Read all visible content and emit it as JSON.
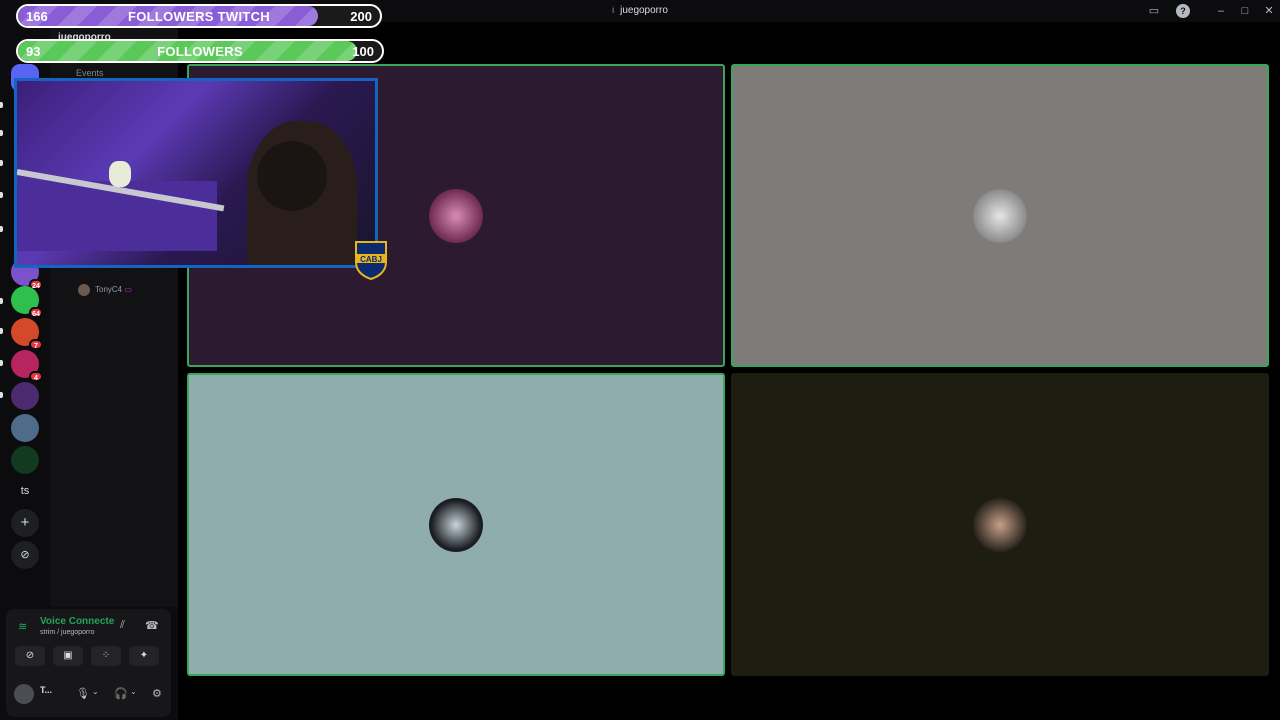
{
  "window": {
    "title": "juegoporro"
  },
  "overlay": {
    "twitch": {
      "current": "166",
      "label": "FOLLOWERS TWITCH",
      "goal": "200",
      "progress": 0.83,
      "color": "#8a5cd6"
    },
    "followers": {
      "current": "93",
      "label": "FOLLOWERS",
      "goal": "100",
      "progress": 0.93,
      "color": "#5ac95a"
    },
    "crest_label": "CABJ"
  },
  "server_header": {
    "name": "juegoporro"
  },
  "channels": {
    "events_label": "Events"
  },
  "members": [
    {
      "name": "TonyC4"
    }
  ],
  "rail": {
    "badges": [
      "24",
      "64",
      "7",
      "4"
    ],
    "text_server": "ts",
    "add_icon": "+",
    "discover_icon": "⊘"
  },
  "voice": {
    "status": "Voice Connecte",
    "channel": "strim / juegoporro"
  },
  "user": {
    "name": "T..."
  },
  "tiles": [
    {
      "name": "tile-1",
      "bg": "#2c1b30"
    },
    {
      "name": "tile-2",
      "bg": "#7f7b78"
    },
    {
      "name": "tile-3",
      "bg": "#8fadad"
    },
    {
      "name": "tile-4",
      "bg": "#1d1d12"
    }
  ]
}
